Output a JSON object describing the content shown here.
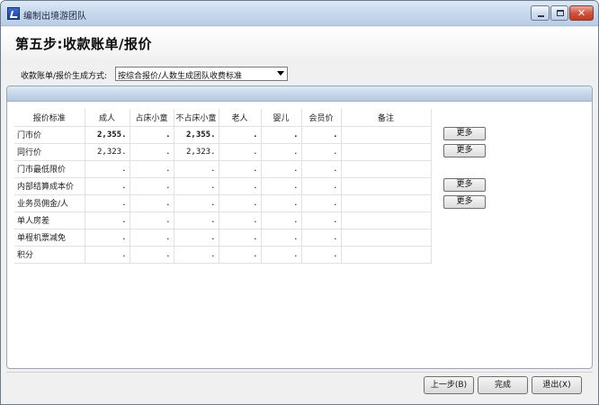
{
  "window": {
    "title": "编制出境游团队"
  },
  "header": {
    "step_title": "第五步:收款账单/报价"
  },
  "mode": {
    "label": "收款账单/报价生成方式:",
    "selected": "按综合报价/人数生成团队收费标准"
  },
  "grid": {
    "headers": [
      "报价标准",
      "成人",
      "占床小童",
      "不占床小童",
      "老人",
      "婴儿",
      "会员价",
      "备注"
    ],
    "rows": [
      {
        "label": "门市价",
        "cells": [
          "2,355.",
          ".",
          "2,355.",
          ".",
          ".",
          ".",
          ""
        ],
        "bold": true
      },
      {
        "label": "同行价",
        "cells": [
          "2,323.",
          ".",
          "2,323.",
          ".",
          ".",
          ".",
          ""
        ],
        "bold": false
      },
      {
        "label": "门市最低限价",
        "cells": [
          ".",
          ".",
          ".",
          ".",
          ".",
          ".",
          ""
        ],
        "bold": false
      },
      {
        "label": "内部结算成本价",
        "cells": [
          ".",
          ".",
          ".",
          ".",
          ".",
          ".",
          ""
        ],
        "bold": false
      },
      {
        "label": "业务员佣金/人",
        "cells": [
          ".",
          ".",
          ".",
          ".",
          ".",
          ".",
          ""
        ],
        "bold": false
      },
      {
        "label": "单人房差",
        "cells": [
          ".",
          ".",
          ".",
          ".",
          ".",
          ".",
          ""
        ],
        "bold": false
      },
      {
        "label": "单程机票减免",
        "cells": [
          ".",
          ".",
          ".",
          ".",
          ".",
          ".",
          ""
        ],
        "bold": false
      },
      {
        "label": "积分",
        "cells": [
          ".",
          ".",
          ".",
          ".",
          ".",
          ".",
          ""
        ],
        "bold": false
      }
    ]
  },
  "more_buttons": {
    "label": "更多"
  },
  "footer": {
    "prev_label": "上一步(B)",
    "finish_label": "完成",
    "exit_label": "退出(X)"
  }
}
